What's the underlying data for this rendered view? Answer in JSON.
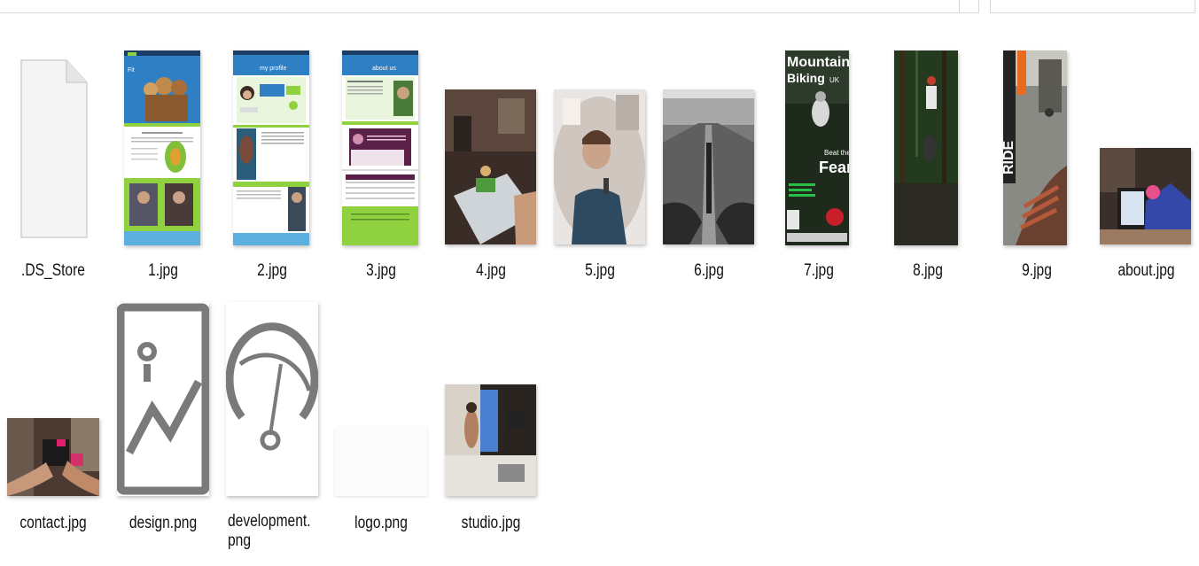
{
  "files": [
    {
      "name": ".DS_Store",
      "kind": "generic-file-icon"
    },
    {
      "name": "1.jpg",
      "kind": "web-mockup-green"
    },
    {
      "name": "2.jpg",
      "kind": "web-mockup-profile"
    },
    {
      "name": "3.jpg",
      "kind": "web-mockup-about"
    },
    {
      "name": "4.jpg",
      "kind": "photo-desk"
    },
    {
      "name": "5.jpg",
      "kind": "photo-fisheye-selfie"
    },
    {
      "name": "6.jpg",
      "kind": "photo-road-bw"
    },
    {
      "name": "7.jpg",
      "kind": "magazine-cover"
    },
    {
      "name": "8.jpg",
      "kind": "photo-bike-forest"
    },
    {
      "name": "9.jpg",
      "kind": "photo-ride-cover"
    },
    {
      "name": "about.jpg",
      "kind": "photo-laptop"
    },
    {
      "name": "contact.jpg",
      "kind": "photo-camera-hands"
    },
    {
      "name": "design.png",
      "kind": "image-placeholder-icon"
    },
    {
      "name": "development.png",
      "kind": "gauge-icon"
    },
    {
      "name": "logo.png",
      "kind": "blank-logo"
    },
    {
      "name": "studio.jpg",
      "kind": "photo-studio"
    }
  ],
  "magazine": {
    "title_line1": "Mountain",
    "title_line2": "Biking",
    "badge": "UK",
    "cover_line1": "Beat the",
    "cover_line2": "Fear"
  },
  "ride_cover": {
    "title": "RIDE"
  },
  "colors": {
    "web_blue": "#2f7fc4",
    "web_green": "#8fd13f",
    "web_purple": "#5b2148",
    "icon_gray": "#7a7a7a"
  }
}
